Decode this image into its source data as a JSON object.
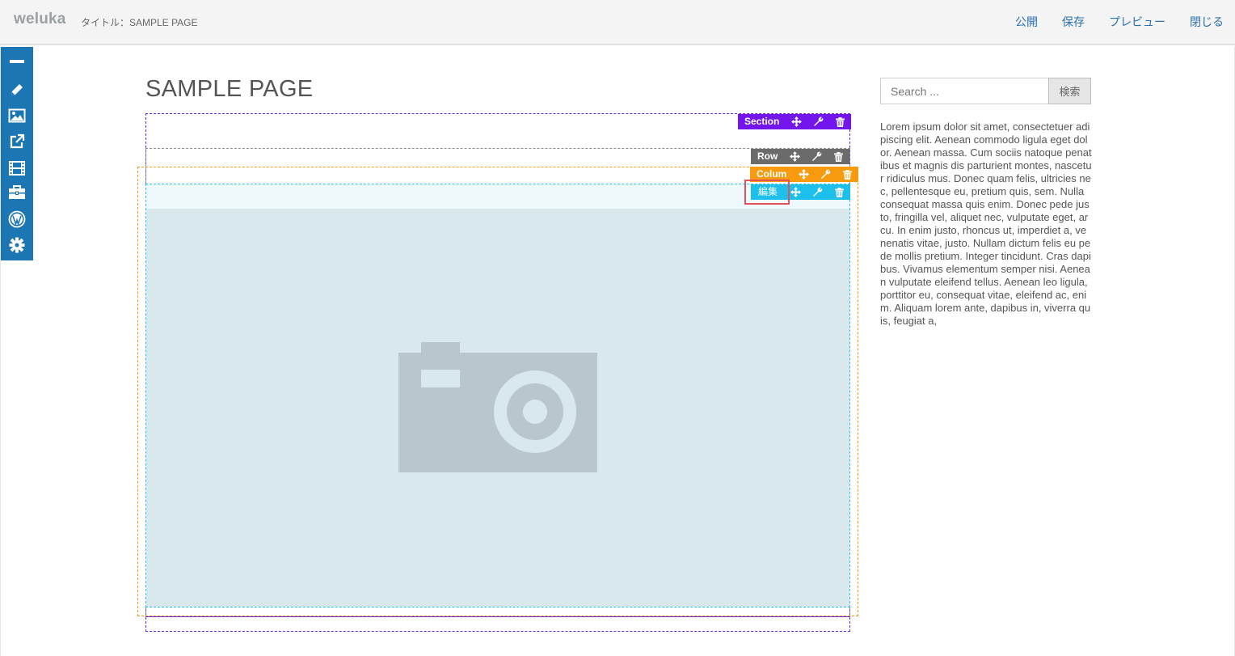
{
  "topbar": {
    "logo": "weluka",
    "title": "タイトル：SAMPLE PAGE",
    "nav": [
      "公開",
      "保存",
      "プレビュー",
      "閉じる"
    ]
  },
  "sidetools": {
    "icons": [
      "minus-icon",
      "pencil-icon",
      "image-icon",
      "external-link-icon",
      "film-icon",
      "briefcase-icon",
      "wordpress-icon",
      "gear-icon"
    ]
  },
  "page": {
    "title": "SAMPLE PAGE"
  },
  "builder": {
    "section_label": "Section",
    "row_label": "Row",
    "column_label": "Colum",
    "element_label": "編集",
    "colors": {
      "section": "#7316ee",
      "row": "#6b6b6b",
      "column": "#f79a0e",
      "element": "#1cc0ea"
    }
  },
  "sidebar": {
    "search_placeholder": "Search ...",
    "search_button": "検索",
    "text": "Lorem ipsum dolor sit amet, consectetuer adipiscing elit. Aenean commodo ligula eget dolor. Aenean massa. Cum sociis natoque penatibus et magnis dis parturient montes, nascetur ridiculus mus. Donec quam felis, ultricies nec, pellentesque eu, pretium quis, sem. Nulla consequat massa quis enim. Donec pede justo, fringilla vel, aliquet nec, vulputate eget, arcu. In enim justo, rhoncus ut, imperdiet a, venenatis vitae, justo. Nullam dictum felis eu pede mollis pretium. Integer tincidunt. Cras dapibus. Vivamus elementum semper nisi. Aenean vulputate eleifend tellus. Aenean leo ligula, porttitor eu, consequat vitae, eleifend ac, enim. Aliquam lorem ante, dapibus in, viverra quis, feugiat a,"
  }
}
